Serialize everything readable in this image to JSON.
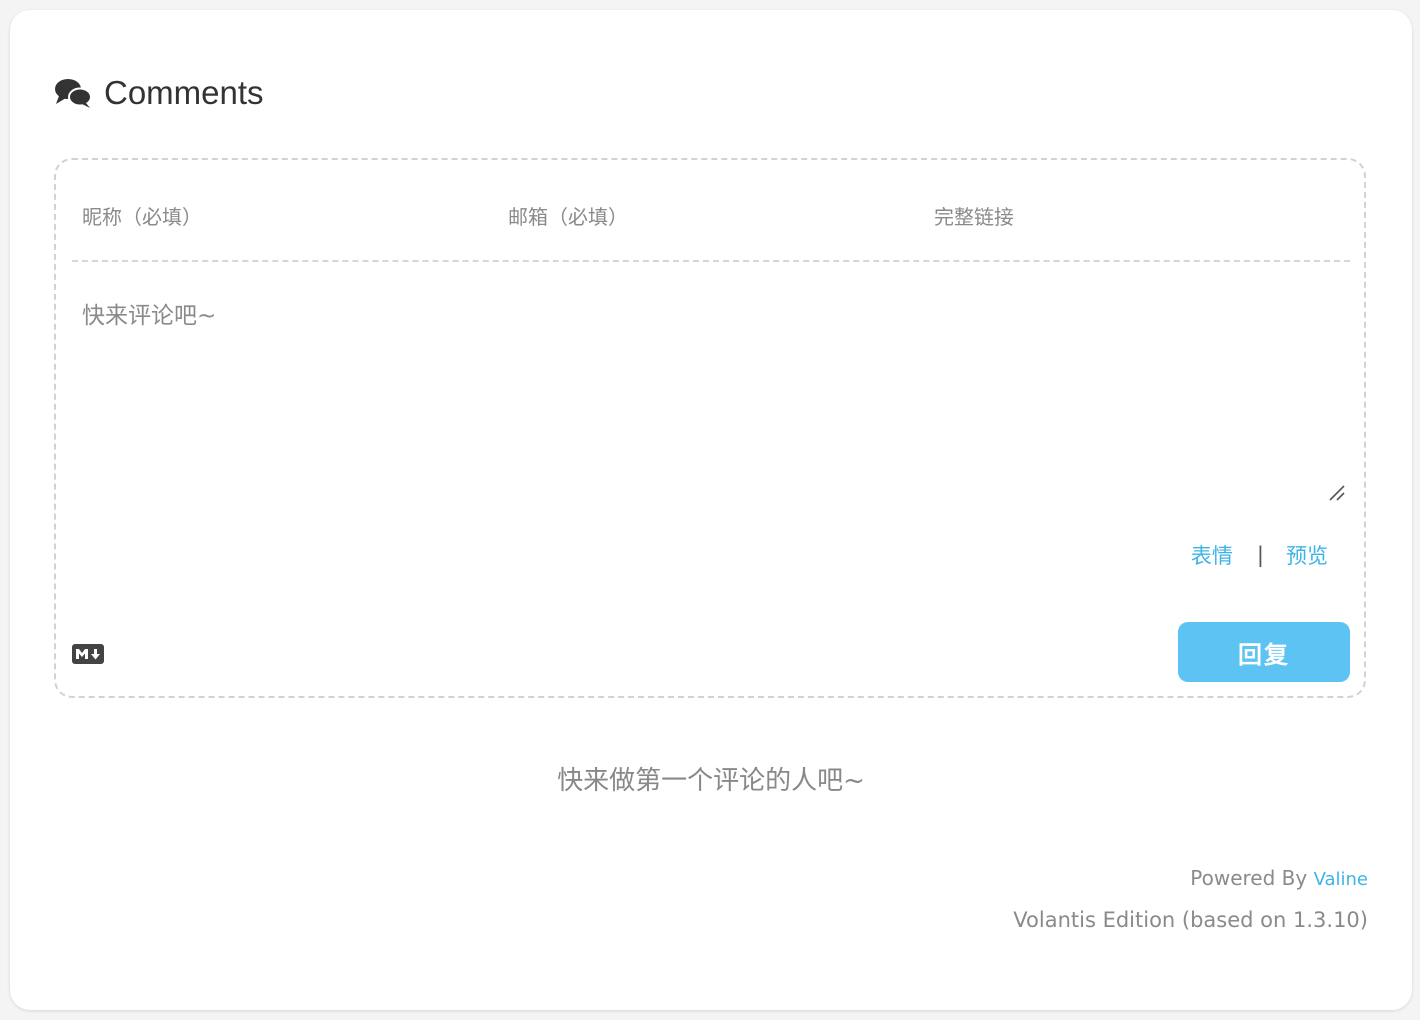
{
  "header": {
    "title": "Comments",
    "icon": "comments-icon"
  },
  "form": {
    "nickname_placeholder": "昵称（必填）",
    "email_placeholder": "邮箱（必填）",
    "link_placeholder": "完整链接",
    "comment_placeholder": "快来评论吧~",
    "emoji_label": "表情",
    "separator": "|",
    "preview_label": "预览",
    "reply_label": "回复",
    "markdown_icon": "markdown-icon"
  },
  "empty_message": "快来做第一个评论的人吧~",
  "footer": {
    "powered_by": "Powered By",
    "valine_link": "Valine",
    "edition": "Volantis Edition (based on 1.3.10)"
  },
  "colors": {
    "accent": "#3eb4e6",
    "button": "#5cc3f2"
  }
}
